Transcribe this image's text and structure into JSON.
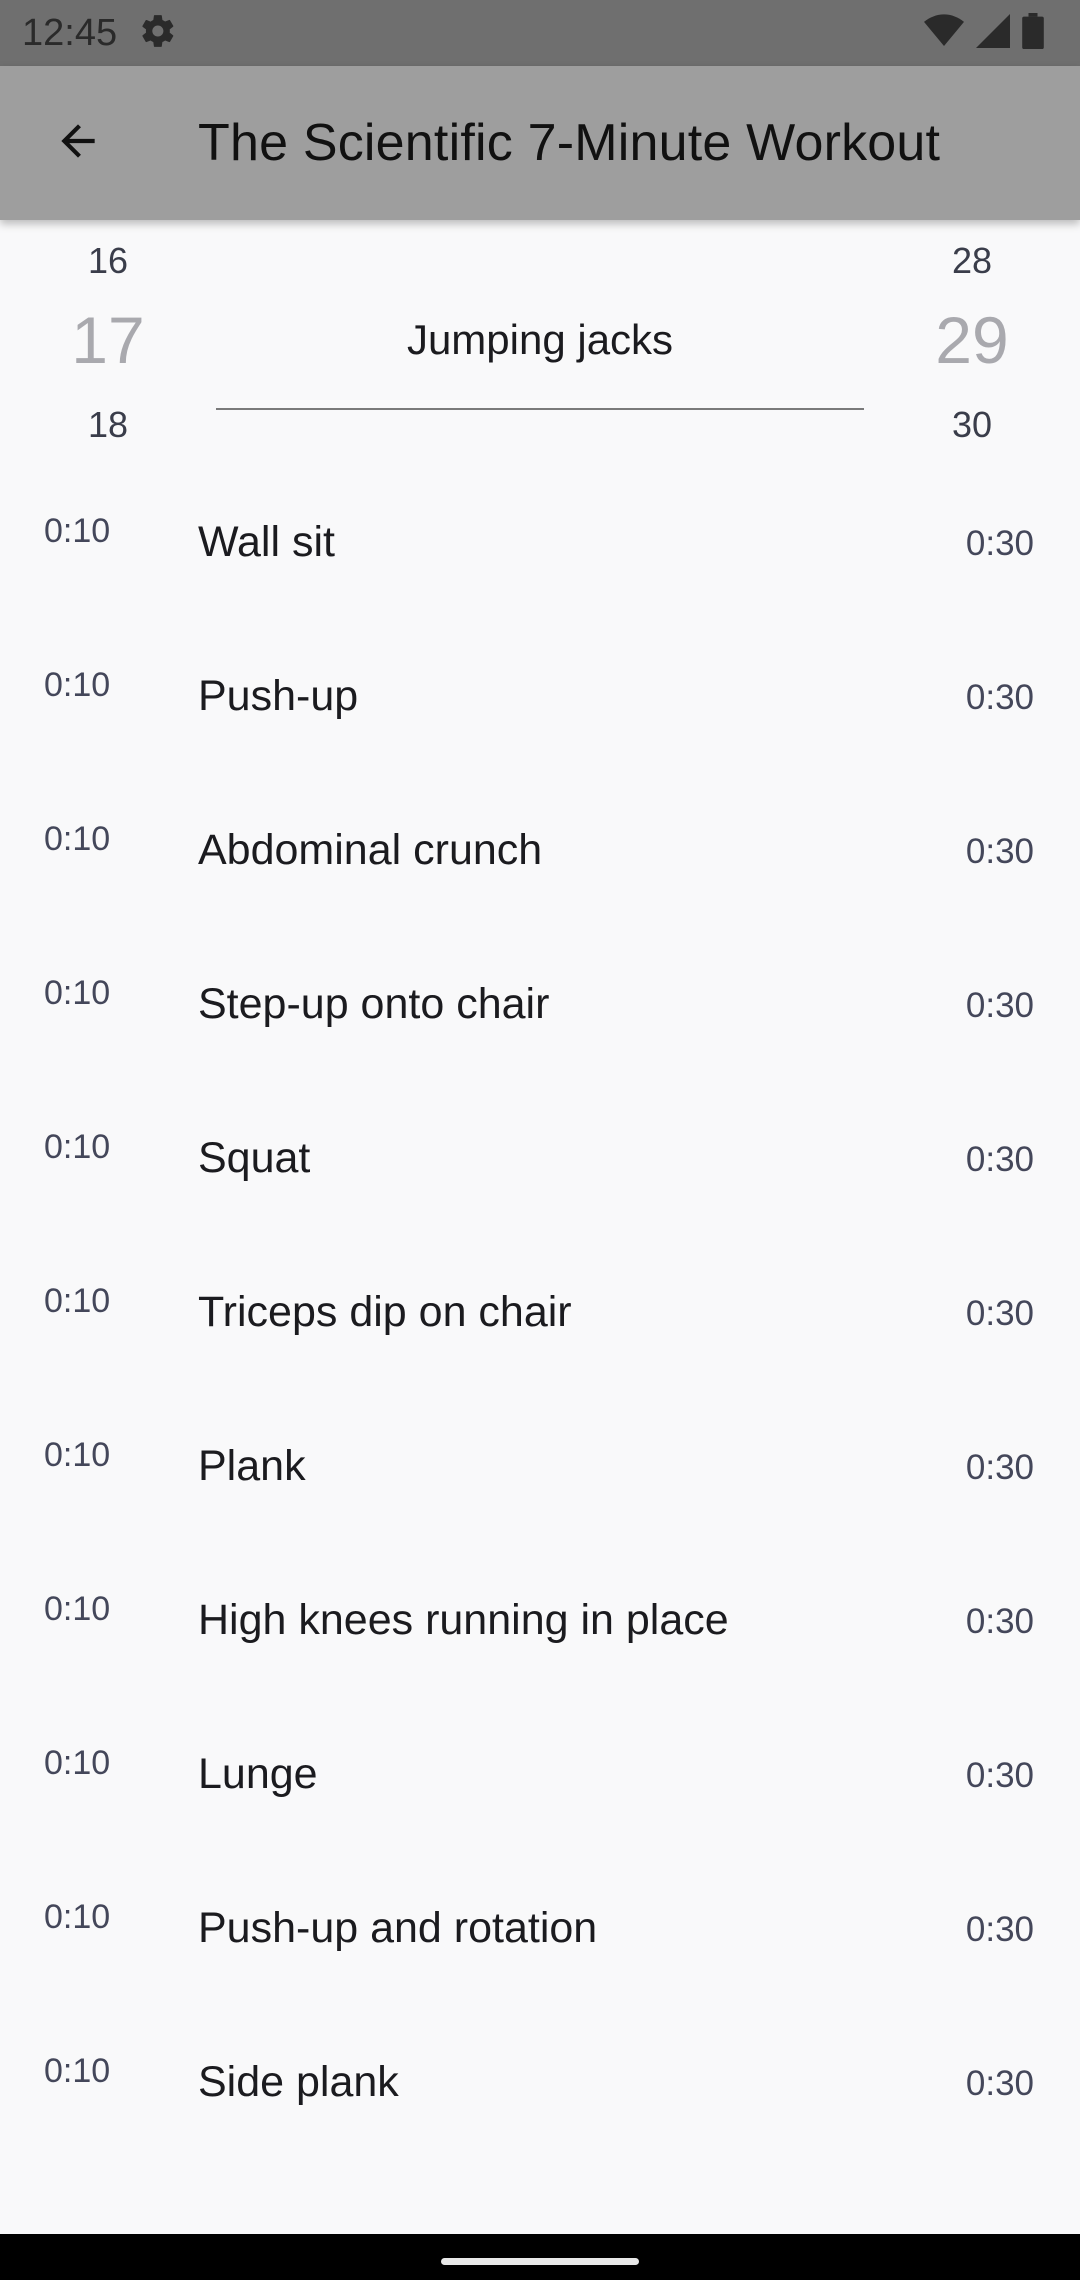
{
  "status_bar": {
    "time": "12:45",
    "icons": [
      "settings-icon",
      "wifi-icon",
      "signal-icon",
      "battery-icon"
    ]
  },
  "app_bar": {
    "back_icon": "arrow-back-icon",
    "title": "The Scientific 7-Minute Workout"
  },
  "picker": {
    "left": {
      "prev": "16",
      "current": "17",
      "next": "18"
    },
    "center": "Jumping jacks",
    "right": {
      "prev": "28",
      "current": "29",
      "next": "30"
    }
  },
  "exercises": [
    {
      "rest": "0:10",
      "name": "Wall sit",
      "duration": "0:30"
    },
    {
      "rest": "0:10",
      "name": "Push-up",
      "duration": "0:30"
    },
    {
      "rest": "0:10",
      "name": "Abdominal crunch",
      "duration": "0:30"
    },
    {
      "rest": "0:10",
      "name": "Step-up onto chair",
      "duration": "0:30"
    },
    {
      "rest": "0:10",
      "name": "Squat",
      "duration": "0:30"
    },
    {
      "rest": "0:10",
      "name": "Triceps dip on chair",
      "duration": "0:30"
    },
    {
      "rest": "0:10",
      "name": "Plank",
      "duration": "0:30"
    },
    {
      "rest": "0:10",
      "name": "High knees running in place",
      "duration": "0:30"
    },
    {
      "rest": "0:10",
      "name": "Lunge",
      "duration": "0:30"
    },
    {
      "rest": "0:10",
      "name": "Push-up and rotation",
      "duration": "0:30"
    },
    {
      "rest": "0:10",
      "name": "Side plank",
      "duration": "0:30"
    }
  ],
  "colors": {
    "status_bar": "#6f6f6f",
    "app_bar": "#9e9e9e",
    "background": "#f9f9fa",
    "text_primary": "#1b1b1f",
    "text_secondary": "#44475a"
  }
}
